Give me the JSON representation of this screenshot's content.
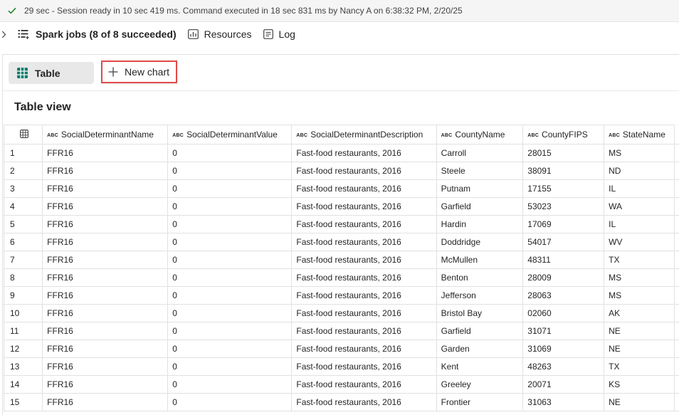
{
  "status": {
    "text": "29 sec - Session ready in 10 sec 419 ms. Command executed in 18 sec 831 ms by Nancy A on 6:38:32 PM, 2/20/25",
    "icon": "checkmark-icon",
    "accent": "#107c10"
  },
  "jobs_bar": {
    "spark_jobs": "Spark jobs (8 of 8 succeeded)",
    "resources": "Resources",
    "log": "Log"
  },
  "toolbar": {
    "table_label": "Table",
    "new_chart_label": "New chart",
    "highlight_color": "#e04b4b"
  },
  "view": {
    "title": "Table view"
  },
  "table": {
    "type_badge": "ABC",
    "columns": [
      "SocialDeterminantName",
      "SocialDeterminantValue",
      "SocialDeterminantDescription",
      "CountyName",
      "CountyFIPS",
      "StateName"
    ],
    "rows": [
      [
        "1",
        "FFR16",
        "0",
        "Fast-food restaurants, 2016",
        "Carroll",
        "28015",
        "MS"
      ],
      [
        "2",
        "FFR16",
        "0",
        "Fast-food restaurants, 2016",
        "Steele",
        "38091",
        "ND"
      ],
      [
        "3",
        "FFR16",
        "0",
        "Fast-food restaurants, 2016",
        "Putnam",
        "17155",
        "IL"
      ],
      [
        "4",
        "FFR16",
        "0",
        "Fast-food restaurants, 2016",
        "Garfield",
        "53023",
        "WA"
      ],
      [
        "5",
        "FFR16",
        "0",
        "Fast-food restaurants, 2016",
        "Hardin",
        "17069",
        "IL"
      ],
      [
        "6",
        "FFR16",
        "0",
        "Fast-food restaurants, 2016",
        "Doddridge",
        "54017",
        "WV"
      ],
      [
        "7",
        "FFR16",
        "0",
        "Fast-food restaurants, 2016",
        "McMullen",
        "48311",
        "TX"
      ],
      [
        "8",
        "FFR16",
        "0",
        "Fast-food restaurants, 2016",
        "Benton",
        "28009",
        "MS"
      ],
      [
        "9",
        "FFR16",
        "0",
        "Fast-food restaurants, 2016",
        "Jefferson",
        "28063",
        "MS"
      ],
      [
        "10",
        "FFR16",
        "0",
        "Fast-food restaurants, 2016",
        "Bristol Bay",
        "02060",
        "AK"
      ],
      [
        "11",
        "FFR16",
        "0",
        "Fast-food restaurants, 2016",
        "Garfield",
        "31071",
        "NE"
      ],
      [
        "12",
        "FFR16",
        "0",
        "Fast-food restaurants, 2016",
        "Garden",
        "31069",
        "NE"
      ],
      [
        "13",
        "FFR16",
        "0",
        "Fast-food restaurants, 2016",
        "Kent",
        "48263",
        "TX"
      ],
      [
        "14",
        "FFR16",
        "0",
        "Fast-food restaurants, 2016",
        "Greeley",
        "20071",
        "KS"
      ],
      [
        "15",
        "FFR16",
        "0",
        "Fast-food restaurants, 2016",
        "Frontier",
        "31063",
        "NE"
      ]
    ]
  }
}
